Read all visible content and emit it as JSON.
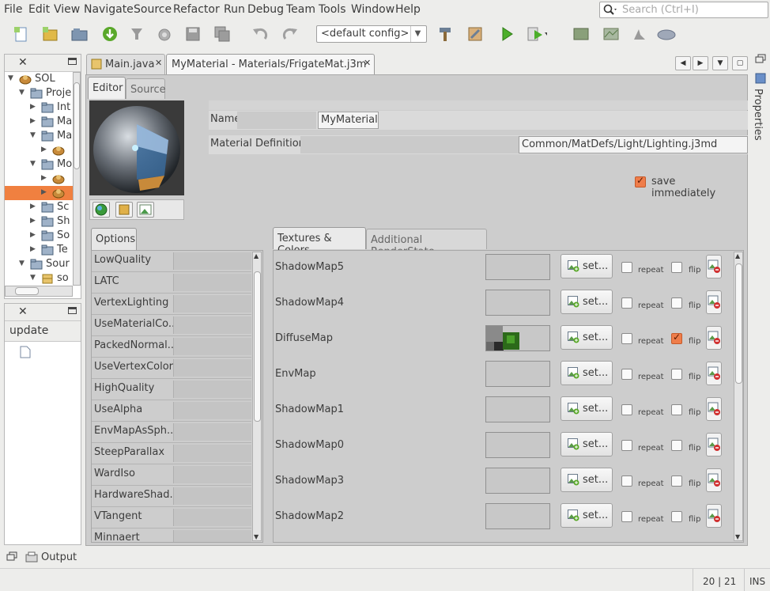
{
  "menu": {
    "items": [
      "File",
      "Edit",
      "View",
      "Navigate",
      "Source",
      "Refactor",
      "Run",
      "Debug",
      "Team",
      "Tools",
      "Window",
      "Help"
    ]
  },
  "search": {
    "placeholder": "Search (Ctrl+I)"
  },
  "toolbar": {
    "config": "<default config>",
    "icons": [
      "new-file-icon",
      "new-project-icon",
      "open-project-icon",
      "download-icon",
      "clean-icon",
      "blender-icon",
      "save-icon",
      "save-all-icon",
      "undo-icon",
      "redo-icon",
      "build-hammer-icon",
      "clean-build-icon",
      "run-icon",
      "debug-icon",
      "scene-icon",
      "terrain-icon",
      "model-icon",
      "cloud-icon"
    ]
  },
  "projects_panel": {
    "rows": [
      {
        "label": "SOL",
        "indent": 0,
        "expanded": true,
        "icon": "jme-icon"
      },
      {
        "label": "Proje",
        "indent": 1,
        "expanded": true,
        "icon": "folder-icon"
      },
      {
        "label": "Int",
        "indent": 2,
        "expanded": false,
        "icon": "folder-icon"
      },
      {
        "label": "Ma",
        "indent": 2,
        "expanded": false,
        "icon": "folder-icon"
      },
      {
        "label": "Ma",
        "indent": 2,
        "expanded": true,
        "icon": "folder-icon"
      },
      {
        "label": "",
        "indent": 3,
        "expanded": false,
        "icon": "jme-icon"
      },
      {
        "label": "Mo",
        "indent": 2,
        "expanded": true,
        "icon": "folder-icon"
      },
      {
        "label": "",
        "indent": 3,
        "expanded": false,
        "icon": "jme-icon"
      },
      {
        "label": "",
        "indent": 3,
        "expanded": false,
        "icon": "jme-icon",
        "selected": true
      },
      {
        "label": "Sc",
        "indent": 2,
        "expanded": false,
        "icon": "folder-icon"
      },
      {
        "label": "Sh",
        "indent": 2,
        "expanded": false,
        "icon": "folder-icon"
      },
      {
        "label": "So",
        "indent": 2,
        "expanded": false,
        "icon": "folder-icon"
      },
      {
        "label": "Te",
        "indent": 2,
        "expanded": false,
        "icon": "folder-icon"
      },
      {
        "label": "Sour",
        "indent": 1,
        "expanded": true,
        "icon": "folder-icon"
      },
      {
        "label": "so",
        "indent": 2,
        "expanded": true,
        "icon": "package-icon"
      }
    ]
  },
  "navigator_panel": {
    "label": "update"
  },
  "tabs": [
    {
      "label": "Main.java",
      "active": false
    },
    {
      "label": "MyMaterial - Materials/FrigateMat.j3m",
      "active": true
    }
  ],
  "editor": {
    "subtabs": [
      "Editor",
      "Source"
    ],
    "name_label": "Name",
    "name_value": "MyMaterial",
    "matdef_label": "Material Definition",
    "matdef_value": "Common/MatDefs/Light/Lighting.j3md",
    "save_immediately_label": "save immediately",
    "save_immediately": true,
    "options_tab": "Options",
    "options": [
      "LowQuality",
      "LATC",
      "VertexLighting",
      "UseMaterialCo...",
      "PackedNormal...",
      "UseVertexColor",
      "HighQuality",
      "UseAlpha",
      "EnvMapAsSph...",
      "SteepParallax",
      "WardIso",
      "HardwareShad...",
      "VTangent",
      "Minnaert"
    ],
    "texture_tabs": [
      "Textures & Colors",
      "Additional RenderState"
    ],
    "set_label": "set...",
    "repeat_label": "repeat",
    "flip_label": "flip",
    "textures": [
      {
        "name": "ShadowMap5",
        "repeat": false,
        "flip": false,
        "has_preview": false
      },
      {
        "name": "ShadowMap4",
        "repeat": false,
        "flip": false,
        "has_preview": false
      },
      {
        "name": "DiffuseMap",
        "repeat": false,
        "flip": true,
        "has_preview": true
      },
      {
        "name": "EnvMap",
        "repeat": false,
        "flip": false,
        "has_preview": false
      },
      {
        "name": "ShadowMap1",
        "repeat": false,
        "flip": false,
        "has_preview": false
      },
      {
        "name": "ShadowMap0",
        "repeat": false,
        "flip": false,
        "has_preview": false
      },
      {
        "name": "ShadowMap3",
        "repeat": false,
        "flip": false,
        "has_preview": false
      },
      {
        "name": "ShadowMap2",
        "repeat": false,
        "flip": false,
        "has_preview": false
      }
    ]
  },
  "right_sidebar": {
    "label": "Properties"
  },
  "output": {
    "label": "Output"
  },
  "status": {
    "position": "20 | 21",
    "mode": "INS"
  }
}
